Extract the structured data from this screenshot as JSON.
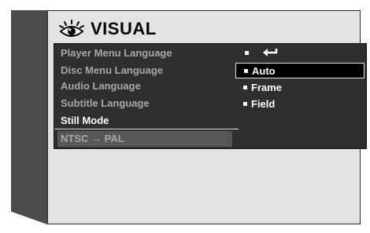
{
  "title": "VISUAL",
  "menu": {
    "items": [
      {
        "label": "Player Menu Language",
        "state": "normal"
      },
      {
        "label": "Disc Menu Language",
        "state": "normal"
      },
      {
        "label": "Audio Language",
        "state": "normal"
      },
      {
        "label": "Subtitle Language",
        "state": "normal"
      },
      {
        "label": "Still Mode",
        "state": "selected"
      },
      {
        "label": "NTSC → PAL",
        "state": "dim"
      }
    ]
  },
  "submenu": {
    "header_icon": "return-arrow-icon",
    "options": [
      {
        "label": "Auto",
        "active": true
      },
      {
        "label": "Frame",
        "active": false
      },
      {
        "label": "Field",
        "active": false
      }
    ]
  },
  "colors": {
    "panel": "#2f2f2f",
    "screen": "#e3e3e3",
    "bezel": "#4b4b4b",
    "item_text": "#a8a8a8",
    "selected_text": "#ffffff"
  }
}
